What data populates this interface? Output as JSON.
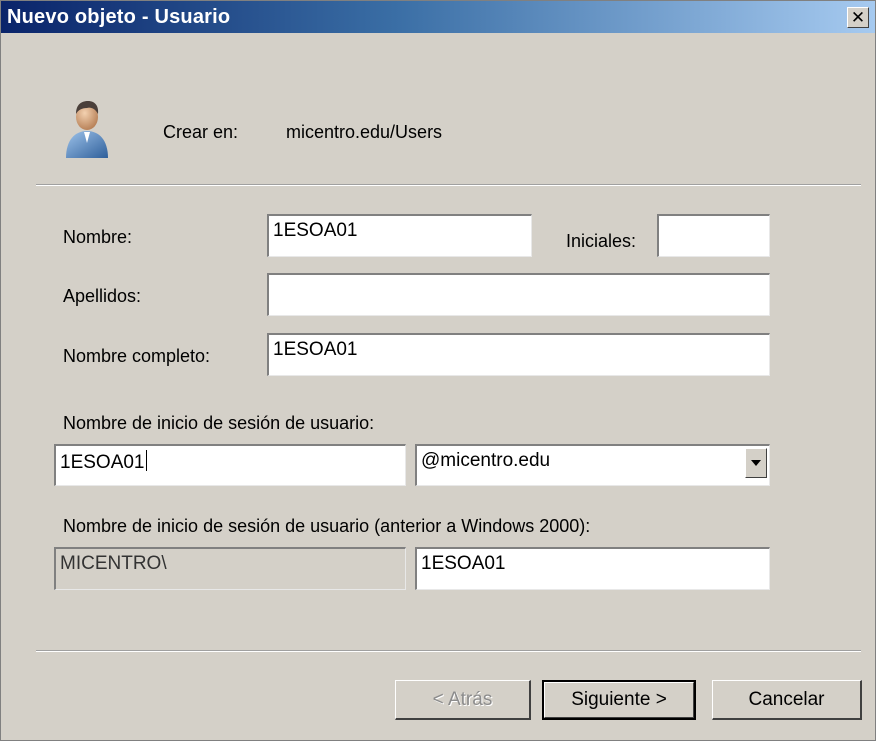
{
  "window": {
    "title": "Nuevo objeto - Usuario",
    "close_symbol": "✕",
    "icon": "user-icon"
  },
  "header": {
    "create_in_label": "Crear en:",
    "create_in_value": "micentro.edu/Users"
  },
  "form": {
    "first_name": {
      "label": "Nombre:",
      "value": "1ESOA01"
    },
    "initials": {
      "label": "Iniciales:",
      "value": ""
    },
    "last_name": {
      "label": "Apellidos:",
      "value": ""
    },
    "full_name": {
      "label": "Nombre completo:",
      "value": "1ESOA01"
    },
    "logon_name": {
      "label": "Nombre de inicio de sesión de usuario:",
      "value": "1ESOA01",
      "domain_selected": "@micentro.edu"
    },
    "pre2000_logon": {
      "label": "Nombre de inicio de sesión de usuario (anterior a Windows 2000):",
      "domain_prefix": "MICENTRO\\",
      "value": "1ESOA01"
    }
  },
  "buttons": {
    "back": "< Atrás",
    "next": "Siguiente >",
    "cancel": "Cancelar"
  }
}
